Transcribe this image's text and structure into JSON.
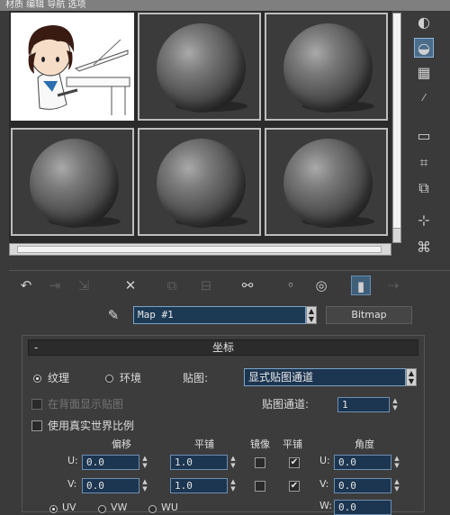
{
  "window": {
    "title_fragment": "材质  编辑  导航  选项"
  },
  "slots": [
    {
      "type": "image",
      "active": true
    },
    {
      "type": "sphere",
      "active": false
    },
    {
      "type": "sphere",
      "active": false
    },
    {
      "type": "sphere",
      "active": false
    },
    {
      "type": "sphere",
      "active": false
    },
    {
      "type": "sphere",
      "active": false
    }
  ],
  "right_toolbar": {
    "icons": [
      "sample-type-icon",
      "backlight-icon",
      "background-checker-icon",
      "uv-tiling-icon",
      "video-color-check-icon",
      "make-preview-icon",
      "options-icon",
      "select-by-material-icon",
      "material-navigator-icon"
    ]
  },
  "bottom_toolbar": {
    "icons": [
      "get-material-icon",
      "put-to-scene-icon",
      "assign-to-selection-icon",
      "reset-map-icon",
      "make-unique-icon",
      "put-to-library-icon",
      "material-id-icon",
      "show-map-in-viewport-icon",
      "show-end-result-icon",
      "go-to-parent-icon",
      "go-forward-to-sibling-icon"
    ]
  },
  "map": {
    "name": "Map #1",
    "type_button": "Bitmap"
  },
  "coordinates": {
    "title": "坐标",
    "collapse_symbol": "-",
    "radio_texture": "纹理",
    "radio_environ": "环境",
    "mapping_label": "贴图:",
    "mapping_value": "显式贴图通道",
    "map_channel_label": "贴图通道:",
    "map_channel_value": "1",
    "show_map_on_back": "在背面显示贴图",
    "use_real_world": "使用真实世界比例",
    "col_offset": "偏移",
    "col_tiling": "平铺",
    "col_mirror": "镜像",
    "col_tile": "平铺",
    "col_angle": "角度",
    "u_label": "U:",
    "v_label": "V:",
    "w_label": "W:",
    "u_offset": "0.0",
    "v_offset": "0.0",
    "u_tiling": "1.0",
    "v_tiling": "1.0",
    "u_angle": "0.0",
    "v_angle": "0.0",
    "w_angle": "0.0",
    "u_label_angle": "U:",
    "v_label_angle": "V:",
    "w_label_angle": "W:",
    "u_mirror": false,
    "v_mirror": false,
    "u_tile": true,
    "v_tile": true,
    "bottom_radio_uv": "UV",
    "bottom_radio_vw": "VW",
    "bottom_radio_wu": "WU"
  }
}
